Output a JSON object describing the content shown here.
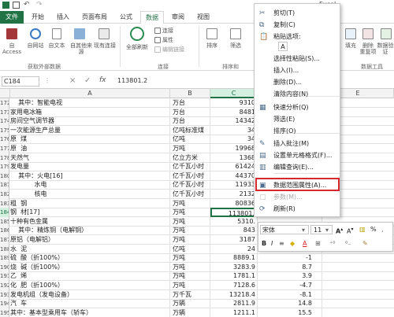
{
  "title": {
    "text": "Excel"
  },
  "tabs": [
    "文件",
    "开始",
    "插入",
    "页面布局",
    "公式",
    "数据",
    "审阅",
    "视图"
  ],
  "ribbon": {
    "btn_access": "自 Access",
    "btn_web": "自网站",
    "btn_text": "自文本",
    "btn_other": "自其他来源",
    "btn_existing": "现有连接",
    "btn_refresh": "全部刷新",
    "btn_connections": "连接",
    "btn_properties": "属性",
    "btn_edit_links": "编辑链接",
    "btn_sort": "排序",
    "btn_filter": "筛选",
    "btn_fill": "填充",
    "btn_remove_dup": "删除\n重复项",
    "btn_validation": "数据验\n证",
    "group_external": "获取外部数据",
    "group_connections": "连接",
    "group_sort": "排序和",
    "group_tools": "数据工具"
  },
  "formula_bar": {
    "name_box": "C184",
    "formula": "113801.2"
  },
  "columns": [
    "A",
    "B",
    "C",
    "D",
    "E"
  ],
  "rows": [
    {
      "num": "172",
      "a": "    其中：智能电视",
      "b": "万台",
      "c": "9310",
      "d": ""
    },
    {
      "num": "173",
      "a": "家用电冰箱",
      "b": "万台",
      "c": "8481",
      "d": ""
    },
    {
      "num": "174",
      "a": "房间空气调节器",
      "b": "万台",
      "c": "14342",
      "d": ""
    },
    {
      "num": "175",
      "a": "一次能源生产总量",
      "b": "亿吨标准煤",
      "c": "34",
      "d": ""
    },
    {
      "num": "176",
      "a": "原  煤",
      "b": "亿吨",
      "c": "34",
      "d": ""
    },
    {
      "num": "177",
      "a": "原  油",
      "b": "万吨",
      "c": "19968",
      "d": ""
    },
    {
      "num": "178",
      "a": "天然气",
      "b": "亿立方米",
      "c": "1368",
      "d": ""
    },
    {
      "num": "179",
      "a": "发电量",
      "b": "亿千瓦小时",
      "c": "61424",
      "d": ""
    },
    {
      "num": "180",
      "a": "    其中：火电[16]",
      "b": "亿千瓦小时",
      "c": "44370",
      "d": ""
    },
    {
      "num": "181",
      "a": "            水电",
      "b": "亿千瓦小时",
      "c": "11933",
      "d": ""
    },
    {
      "num": "182",
      "a": "            核电",
      "b": "亿千瓦小时",
      "c": "2132",
      "d": ""
    },
    {
      "num": "183",
      "a": "粗  钢",
      "b": "万吨",
      "c": "80836",
      "d": ""
    },
    {
      "num": "184",
      "a": "钢  材[17]",
      "b": "万吨",
      "c": "113801.",
      "d": ""
    },
    {
      "num": "185",
      "a": "十种有色金属",
      "b": "万吨",
      "c": "5310.",
      "d": ""
    },
    {
      "num": "186",
      "a": "    其中：精炼铜（电解铜）",
      "b": "万吨",
      "c": "843",
      "d": ""
    },
    {
      "num": "187",
      "a": "原铝（电解铝）",
      "b": "万吨",
      "c": "3187",
      "d": ""
    },
    {
      "num": "188",
      "a": "水  泥",
      "b": "亿吨",
      "c": "24",
      "d": ""
    },
    {
      "num": "189",
      "a": "硫  酸（折100%）",
      "b": "万吨",
      "c": "8889.1",
      "d": "-1"
    },
    {
      "num": "190",
      "a": "烧  碱（折100%）",
      "b": "万吨",
      "c": "3283.9",
      "d": "8.7"
    },
    {
      "num": "191",
      "a": "乙  烯",
      "b": "万吨",
      "c": "1781.1",
      "d": "3.9"
    },
    {
      "num": "192",
      "a": "化  肥（折100%）",
      "b": "万吨",
      "c": "7128.6",
      "d": "-4.7"
    },
    {
      "num": "193",
      "a": "发电机组（发电设备）",
      "b": "万千瓦",
      "c": "13218.4",
      "d": "-8.1"
    },
    {
      "num": "194",
      "a": "汽  车",
      "b": "万辆",
      "c": "2811.9",
      "d": "14.8"
    },
    {
      "num": "195",
      "a": "其中：基本型乘用车（轿车）",
      "b": "万辆",
      "c": "1211.1",
      "d": "15.5"
    }
  ],
  "context_menu": {
    "items": [
      {
        "label": "剪切(T)",
        "icon": "cut-icon",
        "disabled": false
      },
      {
        "label": "复制(C)",
        "icon": "copy-icon",
        "disabled": false
      },
      {
        "label": "粘贴选项:",
        "icon": "paste-icon",
        "disabled": false
      },
      {
        "label": "选择性粘贴(S)...",
        "icon": "",
        "disabled": false
      },
      {
        "label": "插入(I)...",
        "icon": "",
        "disabled": false
      },
      {
        "label": "删除(D)...",
        "icon": "",
        "disabled": false
      },
      {
        "label": "清除内容(N)",
        "icon": "",
        "disabled": false
      },
      {
        "label": "快速分析(Q)",
        "icon": "quick-analysis-icon",
        "disabled": false
      },
      {
        "label": "筛选(E)",
        "icon": "",
        "disabled": false
      },
      {
        "label": "排序(O)",
        "icon": "",
        "disabled": false
      },
      {
        "label": "插入批注(M)",
        "icon": "comment-icon",
        "disabled": false
      },
      {
        "label": "设置单元格格式(F)...",
        "icon": "format-cells-icon",
        "disabled": false
      },
      {
        "label": "编辑查询(E)...",
        "icon": "edit-query-icon",
        "disabled": false
      },
      {
        "label": "数据范围属性(A)...",
        "icon": "range-properties-icon",
        "disabled": false
      },
      {
        "label": "参数(M)...",
        "icon": "parameters-icon",
        "disabled": true
      },
      {
        "label": "刷新(R)",
        "icon": "refresh-icon",
        "disabled": false
      }
    ]
  },
  "mini_toolbar": {
    "font": "宋体",
    "size": "11",
    "percent": "%"
  }
}
